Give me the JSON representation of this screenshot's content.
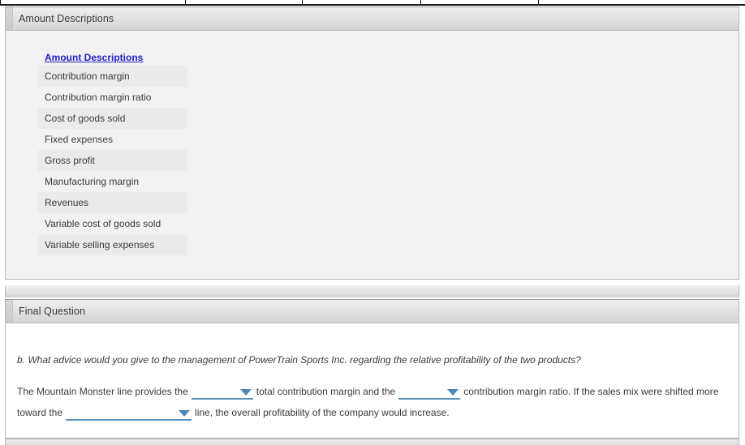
{
  "top_table_strip": {
    "column_divider_positions": [
      228,
      372,
      518,
      663
    ]
  },
  "amount_panel": {
    "header_title": "Amount Descriptions",
    "list_header_link": "Amount Descriptions",
    "items": [
      {
        "label": "Contribution margin",
        "shaded": true
      },
      {
        "label": "Contribution margin ratio",
        "shaded": false
      },
      {
        "label": "Cost of goods sold",
        "shaded": true
      },
      {
        "label": "Fixed expenses",
        "shaded": false
      },
      {
        "label": "Gross profit",
        "shaded": true
      },
      {
        "label": "Manufacturing margin",
        "shaded": false
      },
      {
        "label": "Revenues",
        "shaded": true
      },
      {
        "label": "Variable cost of goods sold",
        "shaded": false
      },
      {
        "label": "Variable selling expenses",
        "shaded": true
      }
    ]
  },
  "final_panel": {
    "header_title": "Final Question",
    "question": "b. What advice would you give to the management of PowerTrain Sports Inc. regarding the relative profitability of the two products?",
    "answer": {
      "segment_1": "The Mountain Monster line provides the",
      "dropdown_1_value": "",
      "segment_2": "total contribution margin and the",
      "dropdown_2_value": "",
      "segment_3": "contribution margin ratio. If the sales mix were shifted more",
      "segment_4": "toward the",
      "dropdown_3_value": "",
      "segment_5": "line, the overall profitability of the company would increase."
    }
  },
  "colors": {
    "link_blue": "#2222cc",
    "dropdown_blue": "#5b8fbe",
    "caret_blue": "#4a86b8",
    "panel_header_gray": "#e3e3e3",
    "amount_body_gray": "#f2f2f2",
    "row_shade_gray": "#ebebeb",
    "border_gray": "#b6b6b6"
  }
}
